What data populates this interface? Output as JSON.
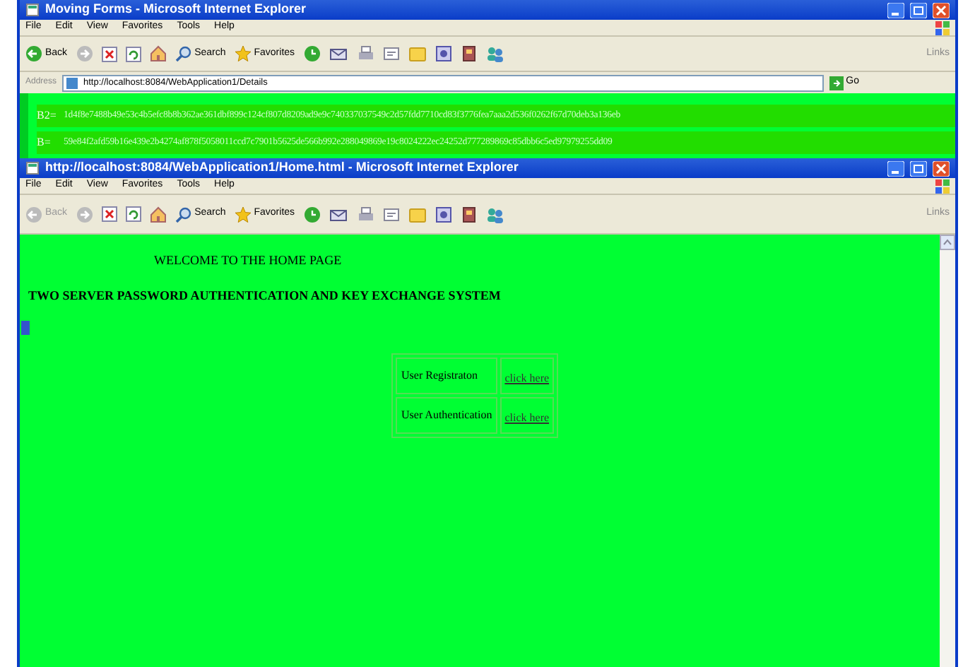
{
  "windows": [
    {
      "title": "Moving Forms - Microsoft Internet Explorer",
      "menu": [
        "File",
        "Edit",
        "View",
        "Favorites",
        "Tools",
        "Help"
      ],
      "back": {
        "label": "Back",
        "disabled": false
      },
      "search": "Search",
      "favorites": "Favorites",
      "address": {
        "label": "Address",
        "url": "http://localhost:8084/WebApplication1/Details",
        "go": "Go"
      },
      "links": "Links",
      "details": [
        {
          "label": "B2=",
          "value": "1d4f8e7488b49e53c4b5efc8b8b362ae361dbf899c124cf807d8209ad9e9c740337037549c2d57fdd7710cd83f3776fea7aaa2d536f0262f67d70deb3a136eb"
        },
        {
          "label": "B=",
          "value": "59e84f2afd59b16e439e2b4274af878f5058011ccd7c7901b5625de566b992e288049869e19c8024222ec24252d777289869c85dbb6c5ed97979255dd09"
        }
      ]
    },
    {
      "title": "http://localhost:8084/WebApplication1/Home.html - Microsoft Internet Explorer",
      "menu": [
        "File",
        "Edit",
        "View",
        "Favorites",
        "Tools",
        "Help"
      ],
      "back": {
        "label": "Back",
        "disabled": true
      },
      "search": "Search",
      "favorites": "Favorites",
      "links": "Links",
      "welcome": "WELCOME TO THE HOME PAGE",
      "heading": "TWO SERVER PASSWORD AUTHENTICATION AND KEY EXCHANGE SYSTEM",
      "table": [
        {
          "label": "User Registraton",
          "link": "click here"
        },
        {
          "label": "User Authentication",
          "link": "click here"
        }
      ]
    }
  ]
}
